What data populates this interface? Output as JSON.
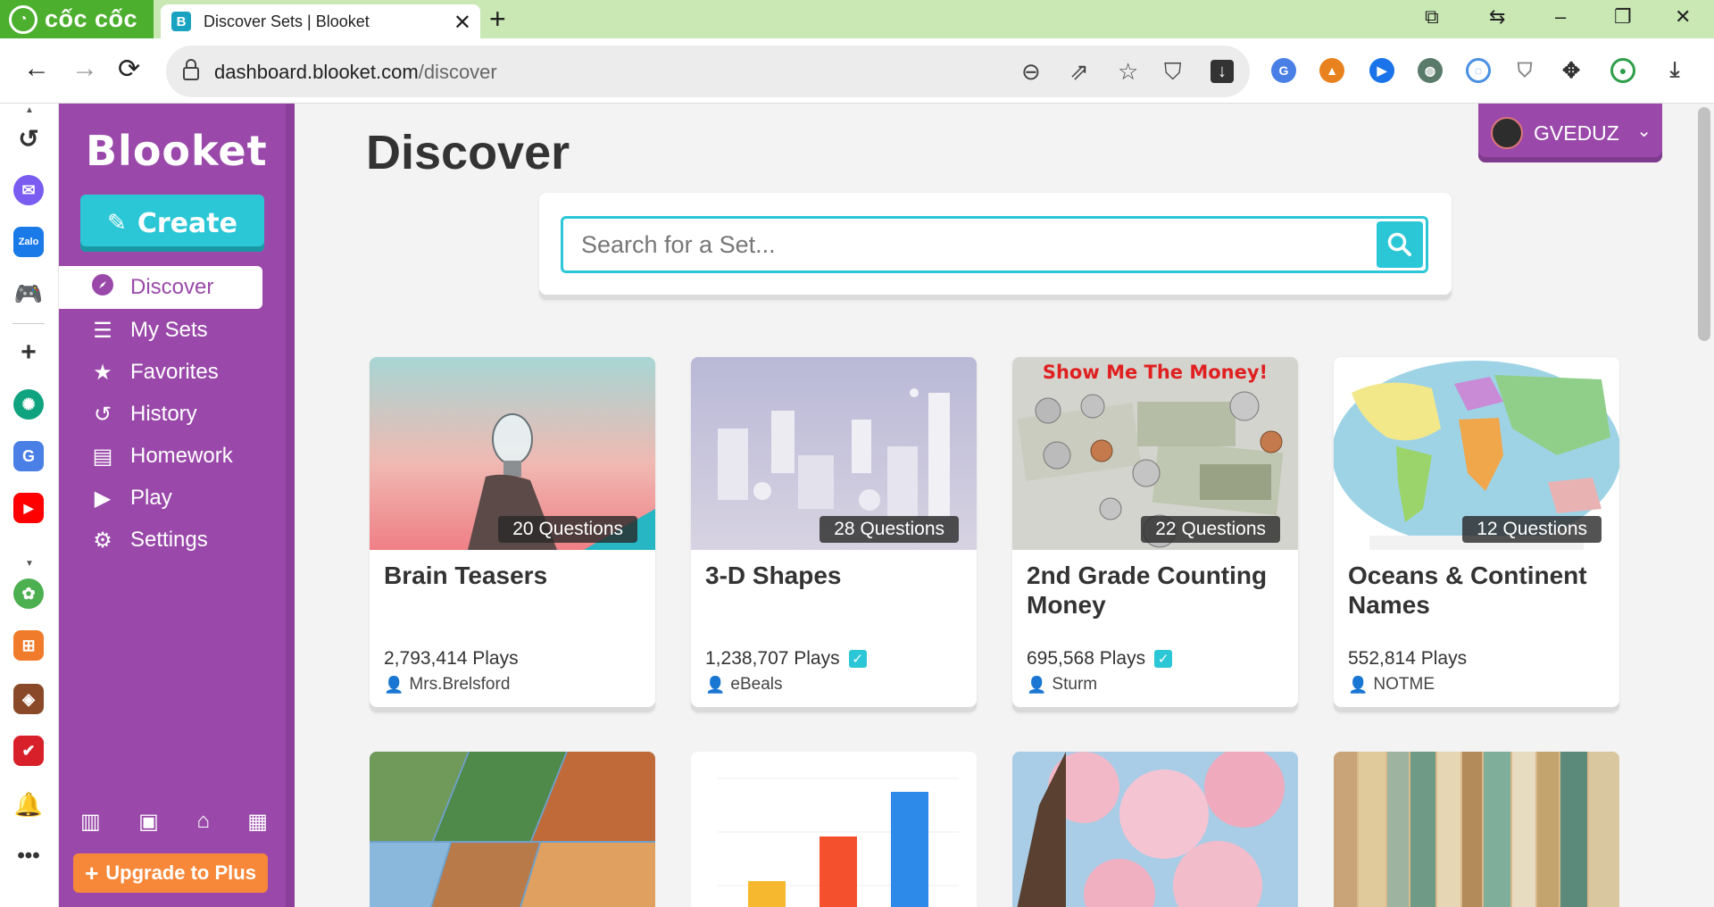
{
  "browser": {
    "brand": "cốc cốc",
    "tab_title": "Discover Sets | Blooket",
    "url_host": "dashboard.blooket.com",
    "url_path": "/discover",
    "tab_favicon_letter": "B"
  },
  "app": {
    "logo": "Blooket",
    "create_label": "Create",
    "nav": [
      {
        "label": "Discover",
        "icon": "compass-icon"
      },
      {
        "label": "My Sets",
        "icon": "list-icon"
      },
      {
        "label": "Favorites",
        "icon": "star-icon"
      },
      {
        "label": "History",
        "icon": "history-icon"
      },
      {
        "label": "Homework",
        "icon": "document-icon"
      },
      {
        "label": "Play",
        "icon": "play-icon"
      },
      {
        "label": "Settings",
        "icon": "gear-icon"
      }
    ],
    "upgrade_label": "Upgrade to Plus",
    "user_name": "GVEDUZ"
  },
  "page": {
    "title": "Discover",
    "search_placeholder": "Search for a Set..."
  },
  "cards": [
    {
      "title": "Brain Teasers",
      "questions": "20 Questions",
      "plays": "2,793,414 Plays",
      "verified": false,
      "author": "Mrs.Brelsford"
    },
    {
      "title": "3-D Shapes",
      "questions": "28 Questions",
      "plays": "1,238,707 Plays",
      "verified": true,
      "author": "eBeals"
    },
    {
      "title": "2nd Grade Counting Money",
      "questions": "22 Questions",
      "plays": "695,568 Plays",
      "verified": true,
      "author": "Sturm",
      "thumb_caption": "Show Me The Money!"
    },
    {
      "title": "Oceans & Continent Names",
      "questions": "12 Questions",
      "plays": "552,814 Plays",
      "verified": false,
      "author": "NOTME"
    }
  ],
  "colors": {
    "purple": "#9a49aa",
    "teal": "#2cc7d6",
    "orange": "#f7883a",
    "tabbar": "#c9e8b4"
  }
}
